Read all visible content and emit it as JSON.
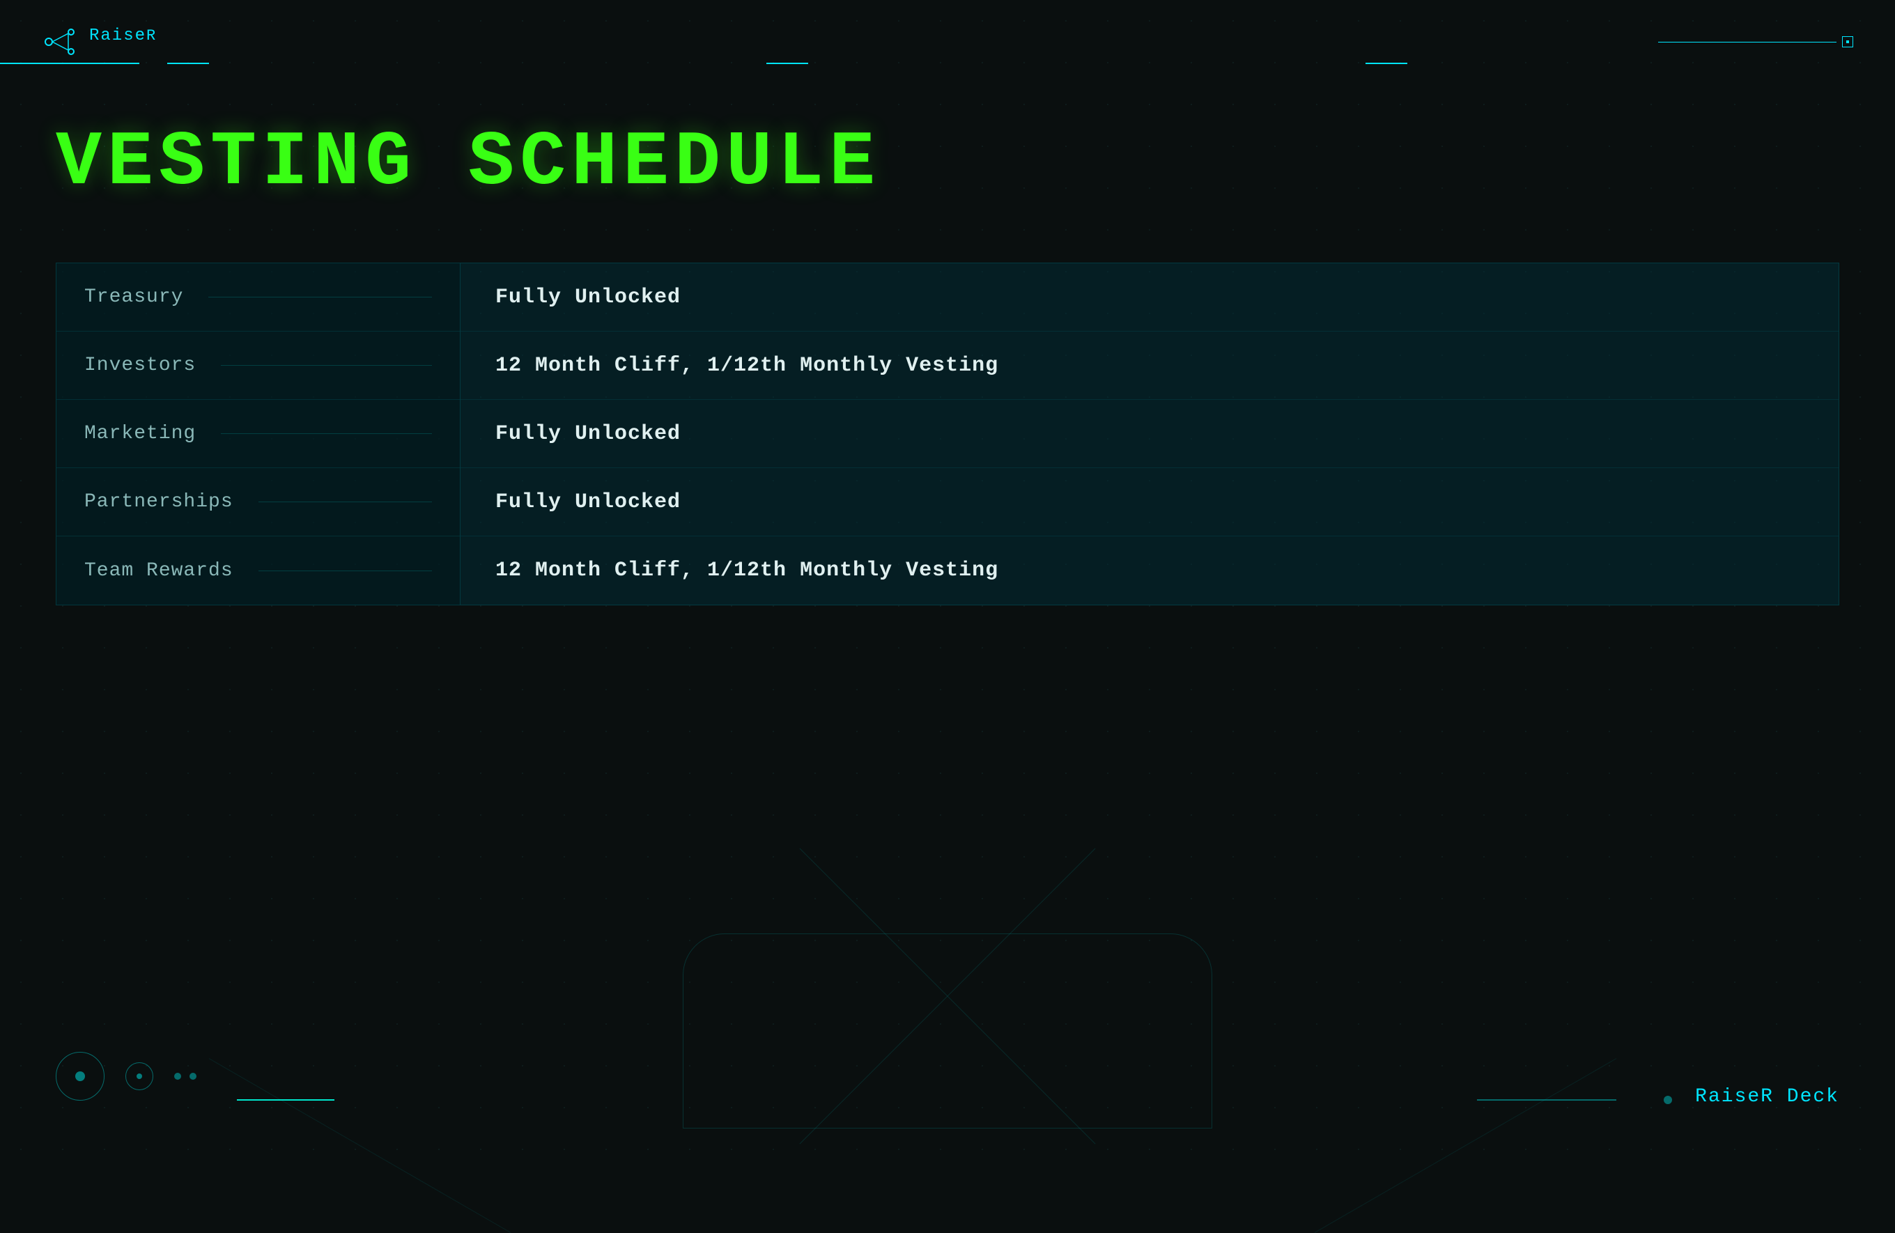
{
  "header": {
    "logo_text": "Raise",
    "logo_superscript": "R",
    "brand_color": "#00e5ff",
    "green_color": "#39ff14"
  },
  "page": {
    "title": "VESTING SCHEDULE"
  },
  "table": {
    "rows": [
      {
        "category": "Treasury",
        "vesting": "Fully Unlocked"
      },
      {
        "category": "Investors",
        "vesting": "12 Month Cliff, 1/12th Monthly Vesting"
      },
      {
        "category": "Marketing",
        "vesting": "Fully Unlocked"
      },
      {
        "category": "Partnerships",
        "vesting": "Fully Unlocked"
      },
      {
        "category": "Team Rewards",
        "vesting": "12 Month Cliff, 1/12th Monthly Vesting"
      }
    ]
  },
  "footer": {
    "brand_label": "RaiseR Deck"
  }
}
